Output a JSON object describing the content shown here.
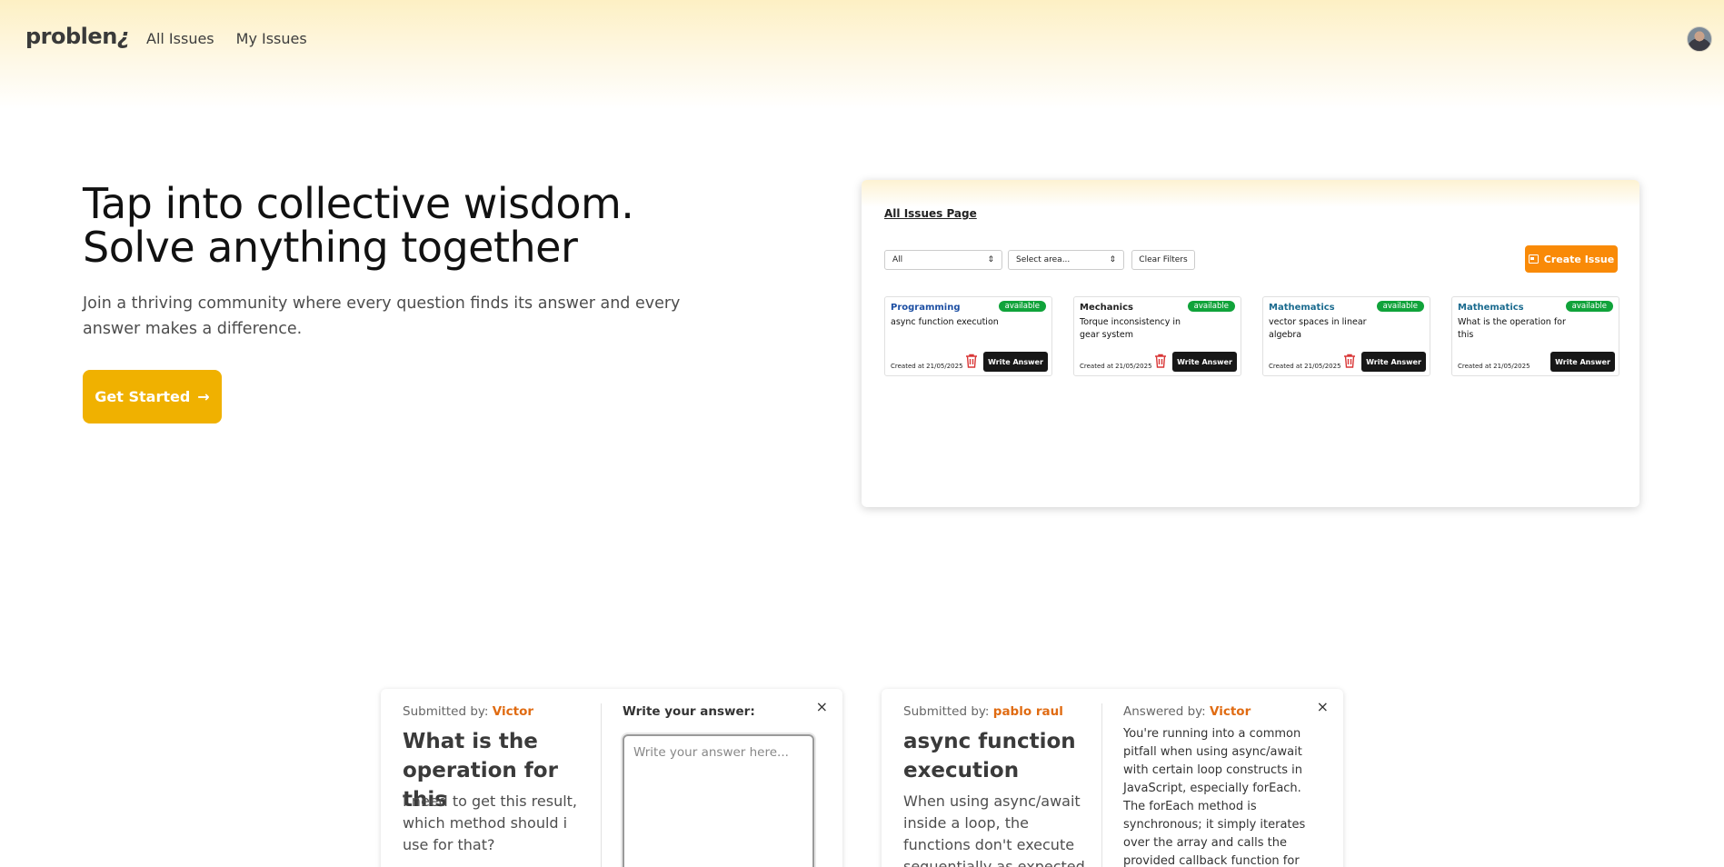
{
  "header": {
    "logo_text": "problen",
    "logo_mark": "¿",
    "nav": [
      "All Issues",
      "My Issues"
    ],
    "avatar": "user-avatar"
  },
  "hero": {
    "title_line1": "Tap into collective wisdom.",
    "title_line2": "Solve anything together",
    "subtitle": "Join a thriving community where every question finds its answer and every answer makes a difference.",
    "cta_label": "Get Started",
    "cta_arrow": "→"
  },
  "preview": {
    "page_title": "All Issues Page",
    "filter_status": "All",
    "filter_area_placeholder": "Select area...",
    "clear_label": "Clear Filters",
    "create_label": "Create Issue",
    "write_label": "Write Answer",
    "cards": [
      {
        "area": "Programming",
        "status": "available",
        "title": "async function execution",
        "created": "Created at 21/05/2025",
        "has_trash": true
      },
      {
        "area": "Mechanics",
        "status": "available",
        "title": "Torque inconsistency in gear system",
        "created": "Created at 21/05/2025",
        "has_trash": true
      },
      {
        "area": "Mathematics",
        "status": "available",
        "title": "vector spaces in linear algebra",
        "created": "Created at 21/05/2025",
        "has_trash": true
      },
      {
        "area": "Mathematics",
        "status": "available",
        "title": "What is the operation for this",
        "created": "Created at 21/05/2025",
        "has_trash": false
      }
    ],
    "colors": {
      "programming": "#1d4fa3",
      "mechanics": "#222222",
      "mathematics": "#1b6b8f",
      "badge": "#10a33a",
      "create": "#f98a07"
    }
  },
  "qa_left": {
    "submitted_prefix": "Submitted by:",
    "submitter": "Victor",
    "title": "What is the operation for this",
    "description": "I need to get this result, which method should i use for that?",
    "answer_label": "Write your answer:",
    "answer_placeholder": "Write your answer here...",
    "close": "×"
  },
  "qa_right": {
    "submitted_prefix": "Submitted by:",
    "submitter": "pablo raul",
    "title": "async function execution",
    "description": "When using async/await inside a loop, the functions don't execute sequentially as expected. This causes",
    "answered_prefix": "Answered by:",
    "answerer": "Victor",
    "answer": "You're running into a common pitfall when using async/await with certain loop constructs in JavaScript, especially forEach. The forEach method is synchronous; it simply iterates over the array and calls the provided callback function for each element. When",
    "close": "×"
  }
}
